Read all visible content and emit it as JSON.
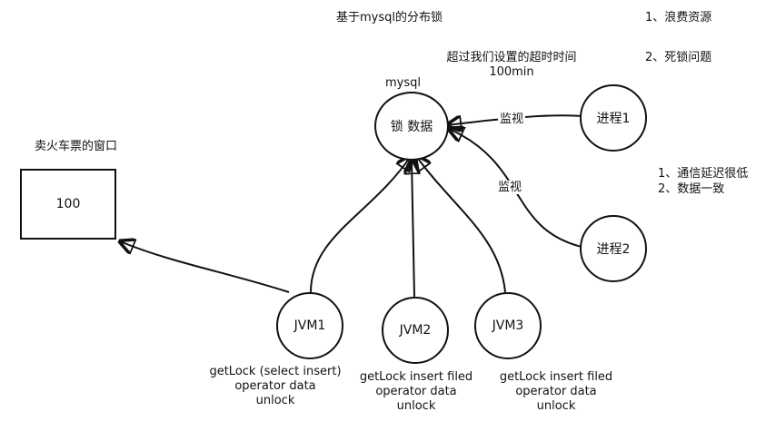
{
  "title": "基于mysql的分布锁",
  "right_notes_top": [
    "1、浪费资源",
    "2、死锁问题"
  ],
  "timeout_note": [
    "超过我们设置的超时时间",
    "100min"
  ],
  "mysql": {
    "label": "mysql",
    "node_text": "锁 数据"
  },
  "processes": [
    {
      "text": "进程1"
    },
    {
      "text": "进程2"
    }
  ],
  "watch_labels": [
    "监视",
    "监视"
  ],
  "right_notes_mid": [
    "1、通信延迟很低",
    "2、数据一致"
  ],
  "window": {
    "label": "卖火车票的窗口",
    "value": "100"
  },
  "jvms": [
    {
      "name": "JVM1",
      "lines": [
        "getLock (select  insert)",
        "operator data",
        "unlock"
      ]
    },
    {
      "name": "JVM2",
      "lines": [
        "getLock  insert filed",
        "operator data",
        "unlock"
      ]
    },
    {
      "name": "JVM3",
      "lines": [
        "getLock  insert filed",
        "operator data",
        "unlock"
      ]
    }
  ]
}
